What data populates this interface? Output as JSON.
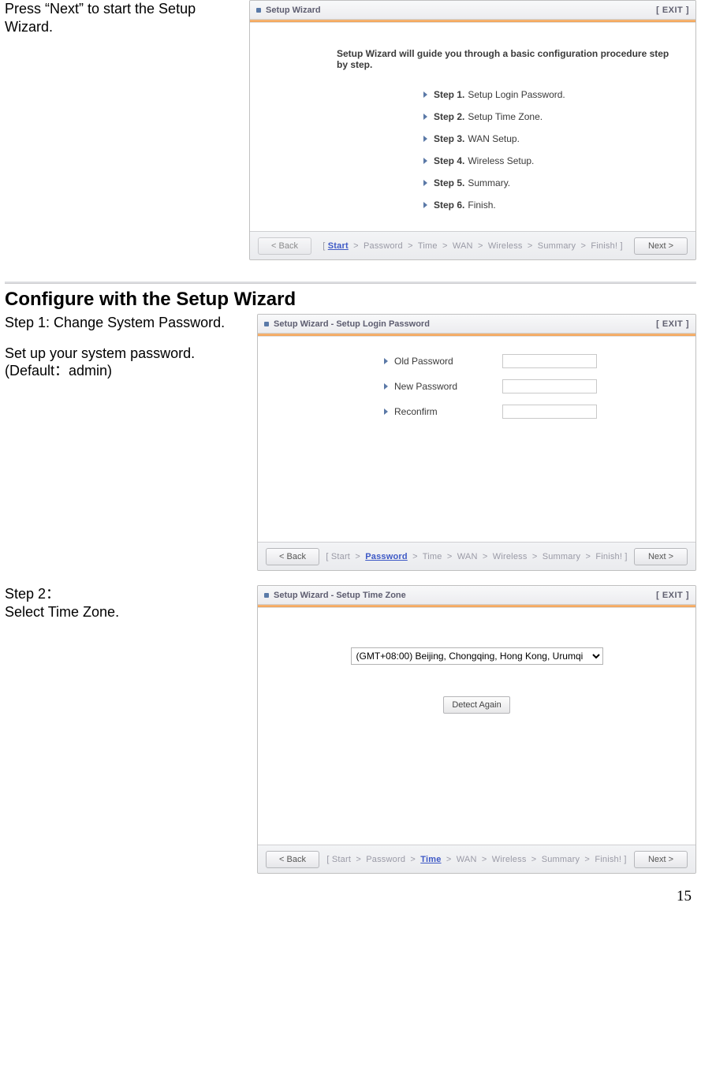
{
  "doc": {
    "page_number": "15",
    "section_heading": "Configure with the Setup Wizard"
  },
  "block1": {
    "caption": "Press “Next” to start the Setup Wizard.",
    "panel_title": "Setup Wizard",
    "exit": "[ EXIT ]",
    "intro_text": "Setup Wizard will guide you through a basic configuration procedure step by step.",
    "steps": [
      {
        "num": "Step 1.",
        "text": "Setup Login Password."
      },
      {
        "num": "Step 2.",
        "text": "Setup Time Zone."
      },
      {
        "num": "Step 3.",
        "text": "WAN Setup."
      },
      {
        "num": "Step 4.",
        "text": "Wireless Setup."
      },
      {
        "num": "Step 5.",
        "text": "Summary."
      },
      {
        "num": "Step 6.",
        "text": "Finish."
      }
    ],
    "back_btn": "< Back",
    "next_btn": "Next >",
    "crumb_brL": "[ ",
    "crumb_brR": " ]",
    "crumbs": {
      "start": "Start",
      "password": "Password",
      "time": "Time",
      "wan": "WAN",
      "wireless": "Wireless",
      "summary": "Summary",
      "finish": "Finish!",
      "sep": ">"
    }
  },
  "block2": {
    "caption_line1": "Step 1: Change System Password.",
    "caption_line2": "Set up your system password. (Default：admin)",
    "panel_title": "Setup Wizard - Setup Login Password",
    "exit": "[ EXIT ]",
    "fields": {
      "old": "Old Password",
      "new": "New Password",
      "re": "Reconfirm"
    },
    "back_btn": "< Back",
    "next_btn": "Next >"
  },
  "block3": {
    "caption_line1": "Step 2：",
    "caption_line2": "Select Time Zone.",
    "panel_title": "Setup Wizard - Setup Time Zone",
    "exit": "[ EXIT ]",
    "tz_value": "(GMT+08:00) Beijing, Chongqing, Hong Kong, Urumqi",
    "detect_btn": "Detect Again",
    "back_btn": "< Back",
    "next_btn": "Next >"
  }
}
